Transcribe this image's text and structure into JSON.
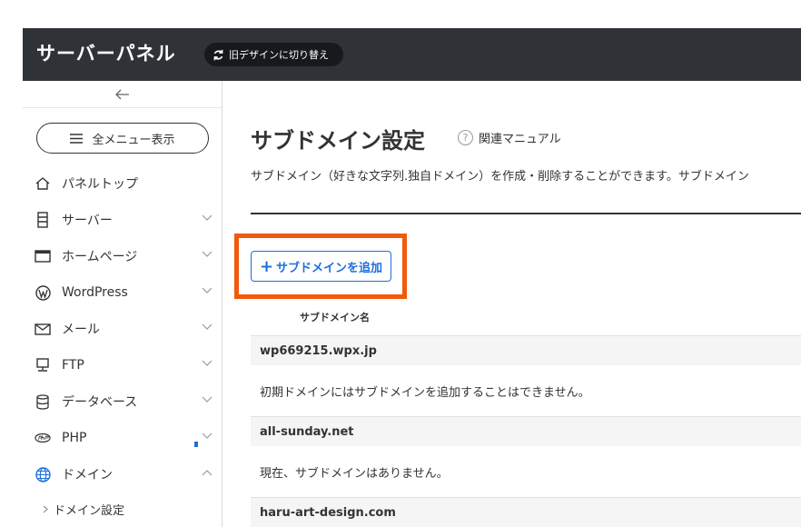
{
  "header": {
    "app_title": "サーバーパネル",
    "old_design_label": "旧デザインに切り替え"
  },
  "sidebar": {
    "all_menu_label": "全メニュー表示",
    "items": [
      {
        "label": "パネルトップ",
        "icon": "home-icon"
      },
      {
        "label": "サーバー",
        "icon": "server-icon"
      },
      {
        "label": "ホームページ",
        "icon": "browser-window-icon"
      },
      {
        "label": "WordPress",
        "icon": "wordpress-icon"
      },
      {
        "label": "メール",
        "icon": "mail-icon"
      },
      {
        "label": "FTP",
        "icon": "monitor-icon"
      },
      {
        "label": "データベース",
        "icon": "database-icon"
      },
      {
        "label": "PHP",
        "icon": "php-icon"
      },
      {
        "label": "ドメイン",
        "icon": "globe-icon"
      }
    ],
    "sub_items": [
      {
        "label": "ドメイン設定"
      }
    ]
  },
  "main": {
    "title": "サブドメイン設定",
    "manual_label": "関連マニュアル",
    "description": "サブドメイン（好きな文字列.独自ドメイン）を作成・削除することができます。サブドメイン",
    "add_button_label": "サブドメインを追加",
    "column_header": "サブドメイン名",
    "domains": [
      {
        "name": "wp669215.wpx.jp",
        "message": "初期ドメインにはサブドメインを追加することはできません。"
      },
      {
        "name": "all-sunday.net",
        "message": "現在、サブドメインはありません。"
      },
      {
        "name": "haru-art-design.com",
        "message": ""
      }
    ]
  },
  "colors": {
    "header_bg": "#2f3237",
    "accent_blue": "#1e6fd9",
    "highlight_orange": "#f15a0a"
  }
}
